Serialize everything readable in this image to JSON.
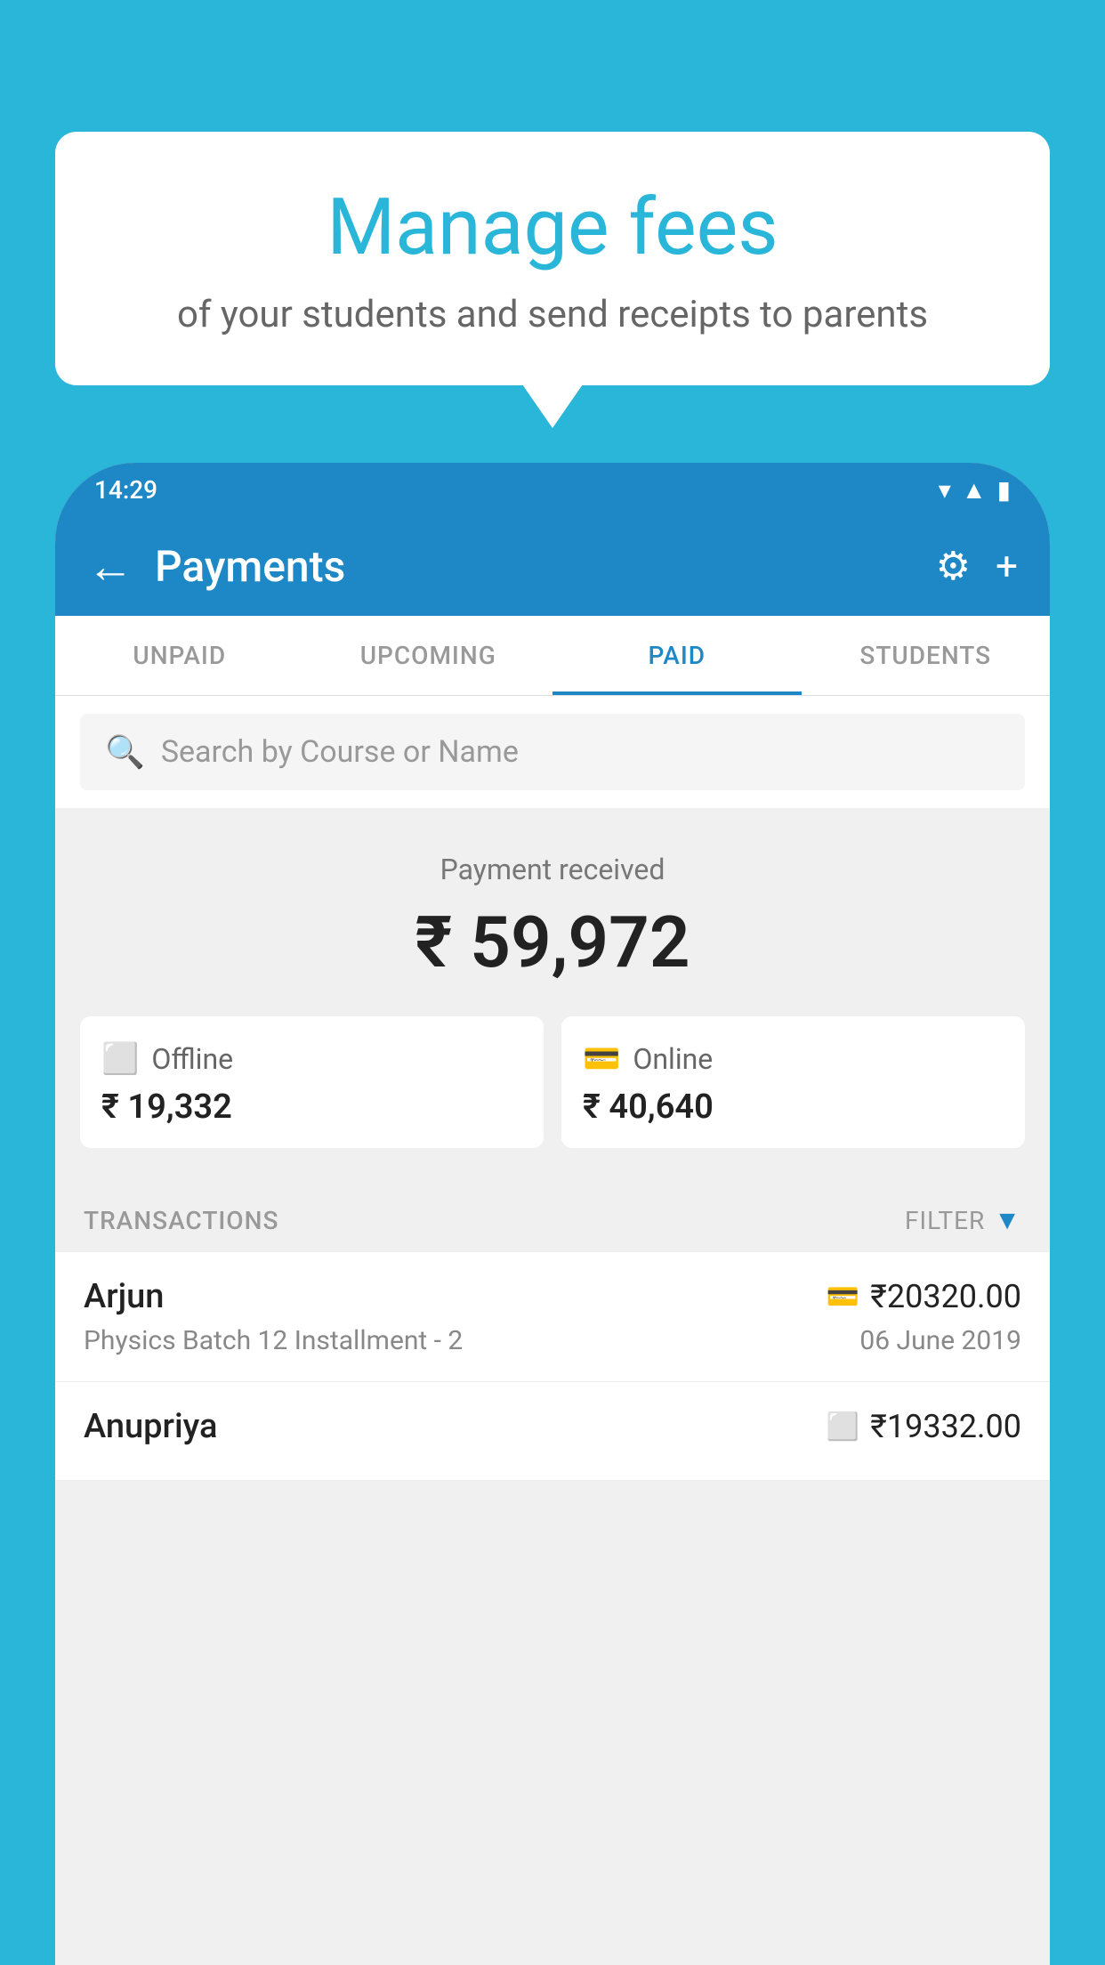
{
  "background_color": "#29b6d8",
  "bubble": {
    "title": "Manage fees",
    "subtitle": "of your students and send receipts to parents"
  },
  "status_bar": {
    "time": "14:29",
    "icons": [
      "wifi",
      "signal",
      "battery"
    ]
  },
  "app_bar": {
    "title": "Payments",
    "back_icon": "←",
    "settings_icon": "⚙",
    "add_icon": "+"
  },
  "tabs": [
    {
      "label": "UNPAID",
      "active": false
    },
    {
      "label": "UPCOMING",
      "active": false
    },
    {
      "label": "PAID",
      "active": true
    },
    {
      "label": "STUDENTS",
      "active": false
    }
  ],
  "search": {
    "placeholder": "Search by Course or Name"
  },
  "payment_summary": {
    "label": "Payment received",
    "total": "₹ 59,972",
    "offline": {
      "label": "Offline",
      "amount": "₹ 19,332"
    },
    "online": {
      "label": "Online",
      "amount": "₹ 40,640"
    }
  },
  "transactions": {
    "section_label": "TRANSACTIONS",
    "filter_label": "FILTER",
    "items": [
      {
        "name": "Arjun",
        "course": "Physics Batch 12 Installment - 2",
        "amount": "₹20320.00",
        "date": "06 June 2019",
        "icon_type": "card"
      },
      {
        "name": "Anupriya",
        "course": "",
        "amount": "₹19332.00",
        "date": "",
        "icon_type": "cash"
      }
    ]
  }
}
